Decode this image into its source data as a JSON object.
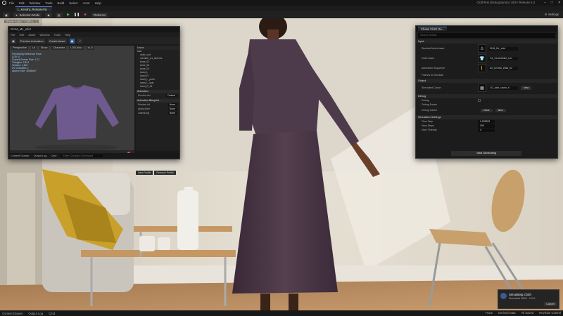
{
  "menubar": {
    "items": [
      "File",
      "Edit",
      "Window",
      "Tools",
      "Build",
      "Select",
      "Actor",
      "Help"
    ],
    "project_path": "ClothTest (DebugGame) | UE5 / Release 5.3"
  },
  "level_tab": {
    "label": "L_Kendra_ReleaseVis"
  },
  "toolbar": {
    "selection_mode": "Selection Mode",
    "platforms": "Platforms",
    "settings": "Settings"
  },
  "viewport": {
    "label": "Ghost Actor / Cloth (...)"
  },
  "cloth_editor": {
    "title": "DIAM_ML_shirt",
    "menu": [
      "File",
      "Edit",
      "Asset",
      "Window",
      "Tools",
      "Help"
    ],
    "toolbar": [
      "Preview Animation",
      "Create Asset"
    ],
    "viewport_bar": [
      "Perspective",
      "Lit",
      "Show",
      "Character",
      "LOD Auto",
      "x1.0"
    ],
    "info_lines": [
      "Previewing Reference Pose",
      "LOD: 0",
      "Current Screen Size: 1.21",
      "Triangles: 2,814",
      "Vertices: 1,624",
      "UV Channels: 1",
      "Approx Size: 36x58x57"
    ],
    "tree_header": "Name",
    "tree_items": [
      "root",
      "cloth_root",
      "member_a1_sleeves",
      "bone_01",
      "bone_02",
      "bone_03",
      "hand_L",
      "hand_R",
      "hand_L_point",
      "hand_L_spin",
      "hand_R_01"
    ],
    "details_sections": [
      "Animation",
      "Animation Blueprint"
    ],
    "props": [
      {
        "label": "Preview Ani",
        "value": "Default"
      },
      {
        "label": "Preview Int",
        "value": "None"
      },
      {
        "label": "Apply Anim",
        "value": "None"
      },
      {
        "label": "Lateral Adj",
        "value": "None"
      }
    ],
    "side_buttons": [
      "New Profile",
      "Remove Profile"
    ],
    "bottom": [
      "Content Drawer",
      "Output Log",
      "Cmd"
    ],
    "cmd_placeholder": "Enter Console Command"
  },
  "generator": {
    "tab": "Chaos Cloth Ge...",
    "search_placeholder": "Search Details",
    "sections": [
      "Input",
      "Output",
      "Debug",
      "Simulation Settings"
    ],
    "input_rows": [
      {
        "label": "Skeletal Mesh Asset",
        "asset": "SKM_ML_shirt"
      },
      {
        "label": "Cloth Asset",
        "asset": "CA_KendraSkirt_bon"
      },
      {
        "label": "Animation Sequence",
        "asset": "AS_kendra_Walk_bo"
      },
      {
        "label": "Frames to Simulate",
        "asset": ""
      }
    ],
    "output_rows": [
      {
        "label": "Simulated Cache",
        "asset": "GC_skirt_cache_b",
        "button": "New"
      }
    ],
    "debug_rows": [
      {
        "label": "Debug"
      },
      {
        "label": "Debug Frame"
      },
      {
        "label": "Debug Cache",
        "button": "Clear",
        "button2": "New"
      }
    ],
    "sim_rows": [
      {
        "label": "Time Step",
        "value": "0.033333"
      },
      {
        "label": "Num Steps",
        "value": "200"
      },
      {
        "label": "Num Threads",
        "value": "4"
      }
    ],
    "start_button": "Start Generating"
  },
  "statusbar": {
    "left": [
      "Content Drawer",
      "Output Log",
      "Cmd"
    ],
    "right": [
      "Trace",
      "Derived Data",
      "All Saved",
      "Revision Control"
    ]
  },
  "toast": {
    "title": "Simulating Cloth",
    "detail": "Simulated 0/601 - 0.0%",
    "cancel": "Cancel"
  },
  "colors": {
    "accent": "#4b7fc7",
    "panel": "#1c1c1c",
    "wall": "#e3dccf",
    "floor": "#b88a5e",
    "garment": "#4a3547"
  }
}
